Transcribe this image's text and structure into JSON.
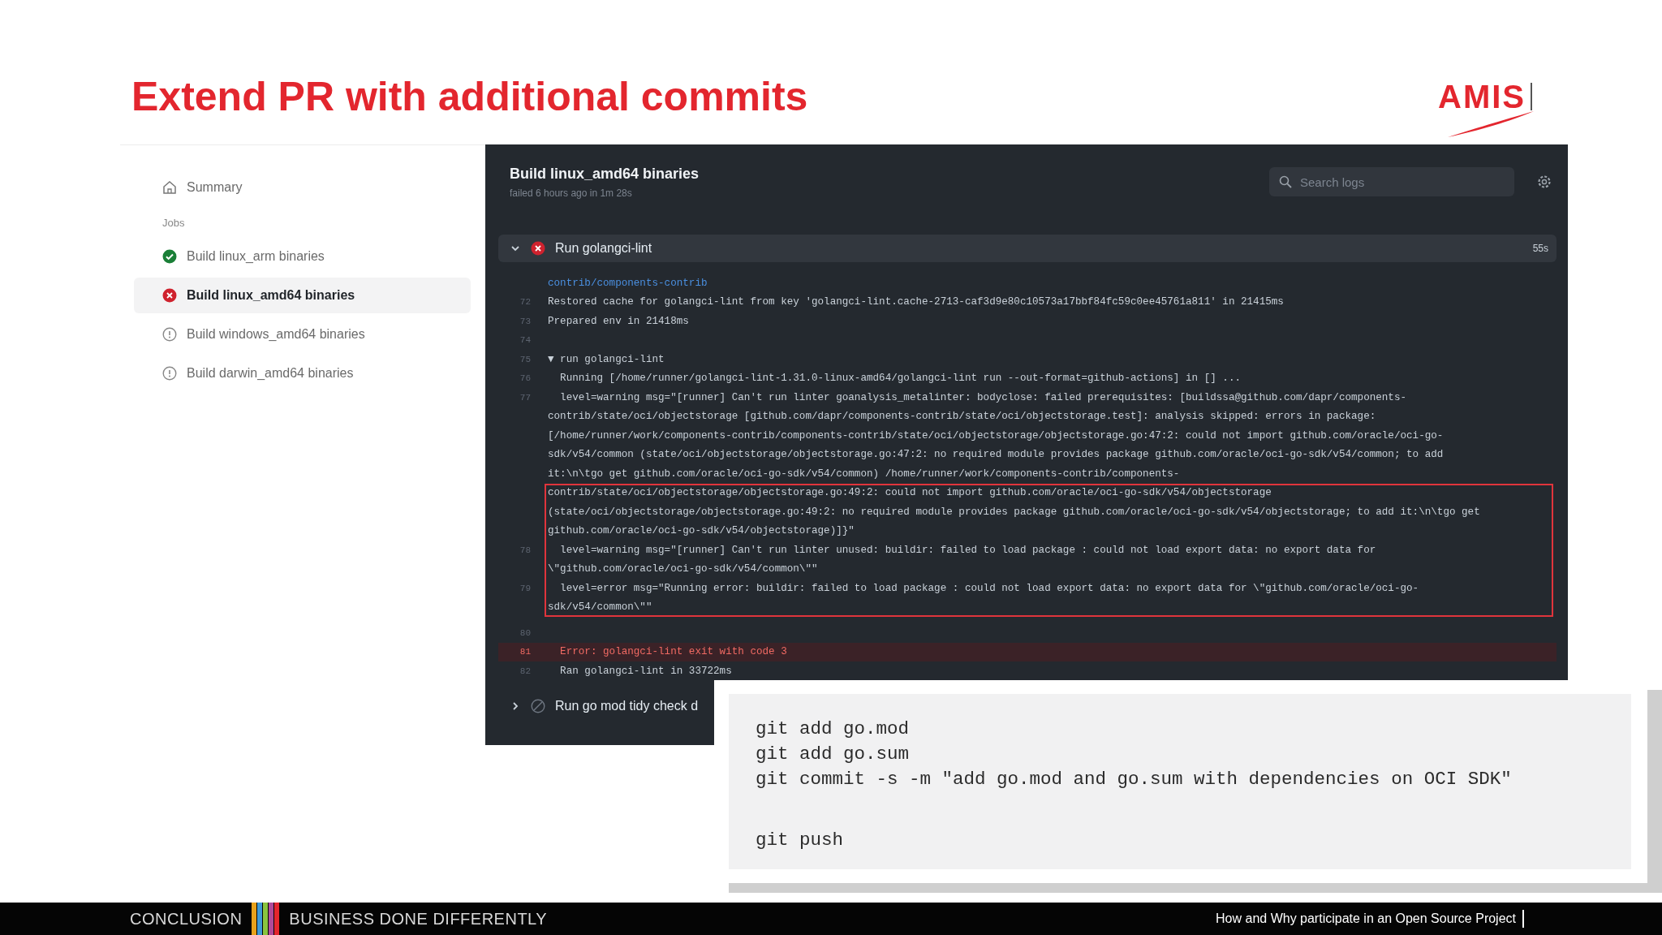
{
  "slide": {
    "title": "Extend PR with additional commits",
    "logo": "AMIS"
  },
  "sidebar": {
    "summary": "Summary",
    "jobs_heading": "Jobs",
    "jobs": [
      {
        "label": "Build linux_arm binaries",
        "kind": "success",
        "selected": false
      },
      {
        "label": "Build linux_amd64 binaries",
        "kind": "failure",
        "selected": true
      },
      {
        "label": "Build windows_amd64 binaries",
        "kind": "pending",
        "selected": false
      },
      {
        "label": "Build darwin_amd64 binaries",
        "kind": "pending",
        "selected": false
      }
    ]
  },
  "log_panel": {
    "title": "Build linux_amd64 binaries",
    "subtitle": "failed 6 hours ago in 1m 28s",
    "search": {
      "placeholder": "Search logs"
    },
    "steps": [
      {
        "name": "Run golangci-lint",
        "kind": "failure",
        "expanded": true,
        "duration": "55s",
        "rows": [
          {
            "kind": "link",
            "boxed": false,
            "text": "contrib/components-contrib"
          },
          {
            "kind": "plain",
            "boxed": false,
            "number": "72",
            "text": "Restored cache for golangci-lint from key 'golangci-lint.cache-2713-caf3d9e80c10573a17bbf84fc59c0ee45761a811' in 21415ms"
          },
          {
            "kind": "plain",
            "boxed": false,
            "number": "73",
            "text": "Prepared env in 21418ms"
          },
          {
            "kind": "plain",
            "boxed": false,
            "number": "74"
          },
          {
            "kind": "group",
            "boxed": false,
            "number": "75",
            "text": "▼ run golangci-lint"
          },
          {
            "kind": "plain",
            "boxed": false,
            "number": "76",
            "text": "  Running [/home/runner/golangci-lint-1.31.0-linux-amd64/golangci-lint run --out-format=github-actions] in [] ..."
          },
          {
            "kind": "plain",
            "boxed": false,
            "number": "77",
            "text": "  level=warning msg=\"[runner] Can't run linter goanalysis_metalinter: bodyclose: failed prerequisites: [buildssa@github.com/dapr/components-"
          },
          {
            "kind": "plain",
            "boxed": false,
            "text": "contrib/state/oci/objectstorage [github.com/dapr/components-contrib/state/oci/objectstorage.test]: analysis skipped: errors in package:"
          },
          {
            "kind": "plain",
            "boxed": false,
            "text": "[/home/runner/work/components-contrib/components-contrib/state/oci/objectstorage/objectstorage.go:47:2: could not import github.com/oracle/oci-go-"
          },
          {
            "kind": "plain",
            "boxed": false,
            "text": "sdk/v54/common (state/oci/objectstorage/objectstorage.go:47:2: no required module provides package github.com/oracle/oci-go-sdk/v54/common; to add"
          },
          {
            "kind": "plain",
            "boxed": false,
            "text": "it:\\n\\tgo get github.com/oracle/oci-go-sdk/v54/common) /home/runner/work/components-contrib/components-"
          },
          {
            "kind": "plain",
            "boxed": true,
            "text": "contrib/state/oci/objectstorage/objectstorage.go:49:2: could not import github.com/oracle/oci-go-sdk/v54/objectstorage"
          },
          {
            "kind": "plain",
            "boxed": true,
            "text": "(state/oci/objectstorage/objectstorage.go:49:2: no required module provides package github.com/oracle/oci-go-sdk/v54/objectstorage; to add it:\\n\\tgo get"
          },
          {
            "kind": "plain",
            "boxed": true,
            "text": "github.com/oracle/oci-go-sdk/v54/objectstorage)]}\""
          },
          {
            "kind": "plain",
            "boxed": true,
            "number": "78",
            "text": "  level=warning msg=\"[runner] Can't run linter unused: buildir: failed to load package : could not load export data: no export data for"
          },
          {
            "kind": "plain",
            "boxed": true,
            "text": "\\\"github.com/oracle/oci-go-sdk/v54/common\\\"\""
          },
          {
            "kind": "plain",
            "boxed": true,
            "number": "79",
            "text": "  level=error msg=\"Running error: buildir: failed to load package : could not load export data: no export data for \\\"github.com/oracle/oci-go-"
          },
          {
            "kind": "plain",
            "boxed": true,
            "text": "sdk/v54/common\\\"\""
          },
          {
            "kind": "plain",
            "boxed": false,
            "number": "80"
          },
          {
            "kind": "error",
            "boxed": false,
            "number": "81",
            "text": "  Error: golangci-lint exit with code 3"
          },
          {
            "kind": "plain",
            "boxed": false,
            "number": "82",
            "text": "  Ran golangci-lint in 33722ms"
          }
        ]
      },
      {
        "name": "Run go mod tidy check d",
        "kind": "skipped",
        "expanded": false
      }
    ]
  },
  "code_box": {
    "blocks": [
      [
        "git add go.mod",
        "git add go.sum",
        "git commit -s -m \"add go.mod and go.sum with dependencies on OCI SDK\""
      ],
      [
        "git push"
      ]
    ]
  },
  "footer": {
    "section": "CONCLUSION",
    "tagline": "BUSINESS DONE DIFFERENTLY",
    "caption": "How and Why participate in an Open Source Project"
  }
}
